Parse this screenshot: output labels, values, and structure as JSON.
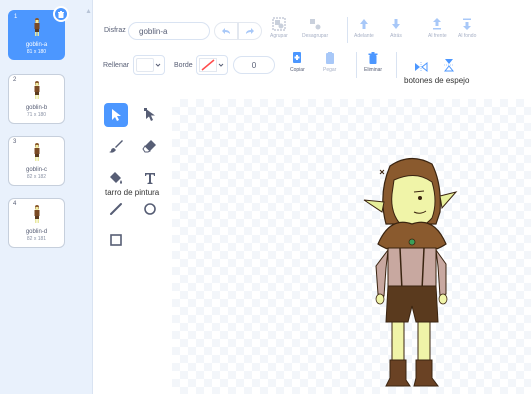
{
  "costumes": [
    {
      "number": "1",
      "name": "goblin-a",
      "size": "81 x 180",
      "selected": true
    },
    {
      "number": "2",
      "name": "goblin-b",
      "size": "71 x 180",
      "selected": false
    },
    {
      "number": "3",
      "name": "goblin-c",
      "size": "82 x 182",
      "selected": false
    },
    {
      "number": "4",
      "name": "goblin-d",
      "size": "82 x 181",
      "selected": false
    }
  ],
  "toolbar": {
    "costume_label": "Disfraz",
    "costume_name": "goblin-a",
    "fill_label": "Rellenar",
    "outline_label": "Borde",
    "outline_width": "0",
    "group": "Agrupar",
    "ungroup": "Desagrupar",
    "forward": "Adelante",
    "backward": "Atrás",
    "front": "Al frente",
    "back": "Al fondo",
    "copy": "Copiar",
    "paste": "Pegar",
    "delete": "Eliminar",
    "flip_label": "botones de espejo"
  },
  "tools": {
    "fill_tool_label": "tarro de pintura"
  },
  "colors": {
    "accent": "#4c97ff",
    "text": "#575e75",
    "disabled": "#a8b1c6",
    "panel_bg": "#e9f1fc"
  },
  "icons": [
    "select-icon",
    "reshape-icon",
    "brush-icon",
    "eraser-icon",
    "fill-icon",
    "text-icon",
    "line-icon",
    "circle-icon",
    "rectangle-icon",
    "undo-icon",
    "redo-icon",
    "copy-icon",
    "paste-icon",
    "trash-icon",
    "flip-horizontal-icon",
    "flip-vertical-icon"
  ]
}
